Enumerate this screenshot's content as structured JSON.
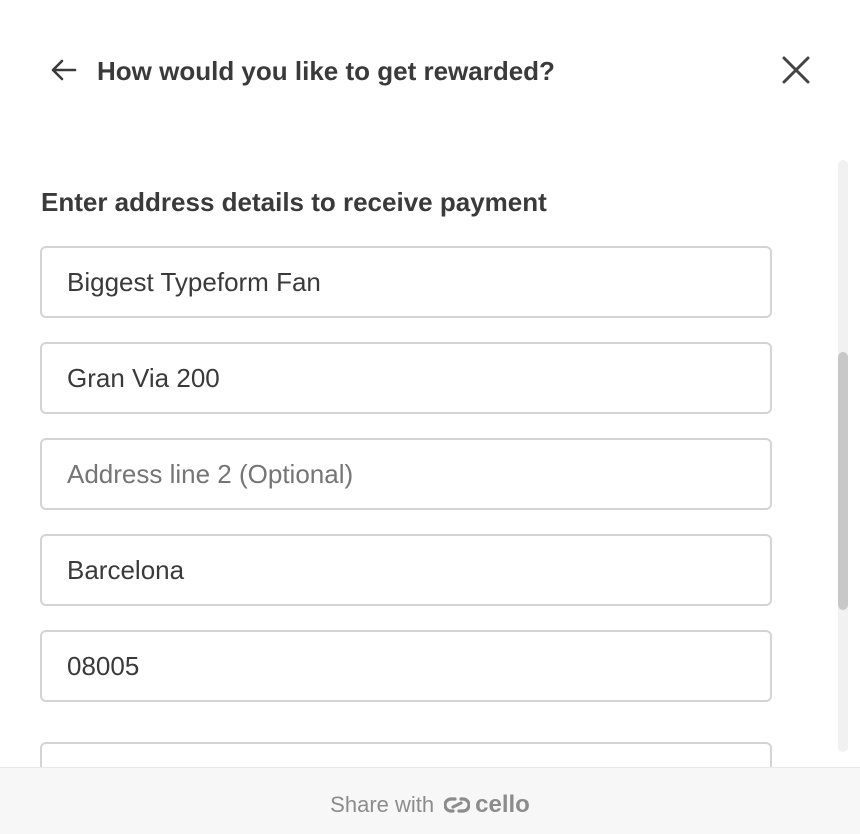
{
  "header": {
    "title": "How would you like to get rewarded?",
    "back_icon": "arrow-left-icon",
    "close_icon": "close-icon"
  },
  "form": {
    "section_title": "Enter address details to receive payment",
    "fields": [
      {
        "value": "Biggest Typeform Fan",
        "placeholder": ""
      },
      {
        "value": "Gran Via 200",
        "placeholder": ""
      },
      {
        "value": "",
        "placeholder": "Address line 2 (Optional)"
      },
      {
        "value": "Barcelona",
        "placeholder": ""
      },
      {
        "value": "08005",
        "placeholder": ""
      },
      {
        "value": "",
        "placeholder": ""
      }
    ]
  },
  "footer": {
    "share_text": "Share with",
    "brand_name": "cello",
    "brand_icon": "cello-logo-icon"
  },
  "colors": {
    "text": "#3a3a3a",
    "border": "#d4d4d4",
    "placeholder": "#757575",
    "footer_bg": "#f7f7f7",
    "footer_text": "#8c8c8c"
  }
}
